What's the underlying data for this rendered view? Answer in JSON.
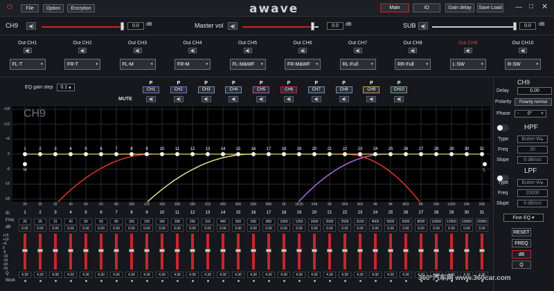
{
  "topbar": {
    "file": "File",
    "option": "Option",
    "encryption": "Encrytion",
    "logo": "awave",
    "main": "Main",
    "io": "IO",
    "gain_delay": "Gain delay",
    "save_load": "Save Load"
  },
  "volume": {
    "ch9_label": "CH9",
    "ch9_value": "0.0",
    "unit": "dB",
    "master_label": "Master vol",
    "master_value": "0.0",
    "sub_label": "SUB",
    "sub_value": "0.0"
  },
  "outputs": [
    {
      "name": "Out CH1",
      "sel": "FL-T"
    },
    {
      "name": "Out CH2",
      "sel": "FR-T"
    },
    {
      "name": "Out CH3",
      "sel": "FL-M"
    },
    {
      "name": "Out CH4",
      "sel": "FR-M"
    },
    {
      "name": "Out CH5",
      "sel": "FL-M&WF"
    },
    {
      "name": "Out CH6",
      "sel": "FR-M&WF"
    },
    {
      "name": "Out CH7",
      "sel": "RL-Full"
    },
    {
      "name": "Out CH8",
      "sel": "RR-Full"
    },
    {
      "name": "Out CH9",
      "sel": "L-SW"
    },
    {
      "name": "Out CH10",
      "sel": "R-SW"
    }
  ],
  "eq": {
    "gain_step_label": "EQ gain step",
    "gain_step_value": "0.1",
    "mute_label": "MUTE",
    "p": "P",
    "channels": [
      "CH1",
      "CH2",
      "CH3",
      "CH4",
      "CH5",
      "CH6",
      "CH7",
      "CH8",
      "CH9",
      "CH10"
    ],
    "graph_title": "CH9",
    "h_marker": "H",
    "l_marker": "L",
    "y_ticks": [
      "+18",
      "+12",
      "+6",
      "0",
      "-6",
      "-12",
      "-18"
    ],
    "x_ticks": [
      "20",
      "25",
      "32",
      "40",
      "50",
      "63",
      "80",
      "100",
      "125",
      "160",
      "200",
      "250",
      "315",
      "400",
      "500",
      "630",
      "800",
      "1K",
      "1K25",
      "1K6",
      "2K",
      "2K5",
      "3K2",
      "4K",
      "5K",
      "6K3",
      "8K",
      "10K",
      "12K5",
      "16K",
      "20K"
    ],
    "row_labels": {
      "id": "ID",
      "freq": "F/Hz",
      "db": "dB",
      "q": "Q",
      "work": "Work"
    },
    "fader_ticks": [
      "+15",
      "+10",
      "+5",
      "0",
      "-5",
      "-10",
      "-15",
      "-20",
      "-25"
    ],
    "freqs": [
      "20",
      "25",
      "31",
      "40",
      "50",
      "63",
      "80",
      "100",
      "125",
      "160",
      "200",
      "250",
      "315",
      "400",
      "500",
      "630",
      "800",
      "1000",
      "1250",
      "1600",
      "2000",
      "2500",
      "3150",
      "4000",
      "5000",
      "6300",
      "8000",
      "10000",
      "12500",
      "16000",
      "20000"
    ],
    "db_values": [
      "0.00",
      "0.00",
      "0.00",
      "0.00",
      "0.00",
      "0.00",
      "0.00",
      "0.00",
      "0.00",
      "0.00",
      "0.00",
      "0.00",
      "0.00",
      "0.00",
      "0.00",
      "0.00",
      "0.00",
      "0.00",
      "0.00",
      "0.00",
      "0.00",
      "0.00",
      "0.00",
      "0.00",
      "0.00",
      "0.00",
      "0.00",
      "0.00",
      "0.00",
      "0.00",
      "0.00"
    ],
    "q_values": [
      "4.30",
      "4.30",
      "4.30",
      "4.30",
      "4.30",
      "4.30",
      "4.30",
      "4.30",
      "4.30",
      "4.30",
      "4.30",
      "4.30",
      "4.30",
      "4.30",
      "4.30",
      "4.30",
      "4.30",
      "4.30",
      "4.30",
      "4.30",
      "4.30",
      "4.30",
      "4.30",
      "4.30",
      "4.30",
      "4.30",
      "4.30",
      "4.30",
      "4.30",
      "4.30",
      "4.30"
    ]
  },
  "right": {
    "title": "CH9",
    "delay_label": "Delay",
    "delay_value": "0.00",
    "polarity_label": "Polarity",
    "polarity_value": "Polarity normal",
    "phase_label": "Phase",
    "phase_minus": "-",
    "phase_value": "0°",
    "phase_plus": "+",
    "hpf": {
      "title": "HPF",
      "type_label": "Type",
      "type": "Butter-W",
      "freq_label": "Freq",
      "freq": "20",
      "slope_label": "Slope",
      "slope": "6 dB/oct"
    },
    "lpf": {
      "title": "LPF",
      "type_label": "Type",
      "type": "Butter-W",
      "freq_label": "Freq",
      "freq": "20000",
      "slope_label": "Slope",
      "slope": "6 dB/oct"
    },
    "fine_eq": "Fine EQ",
    "reset": "RESET",
    "freq_btn": "FREQ",
    "db_btn": "dB",
    "q_btn": "Q"
  },
  "watermark": "360°汽车网 www.360car.com",
  "colors": {
    "accent": "#c8262a",
    "background": "#16181d"
  }
}
